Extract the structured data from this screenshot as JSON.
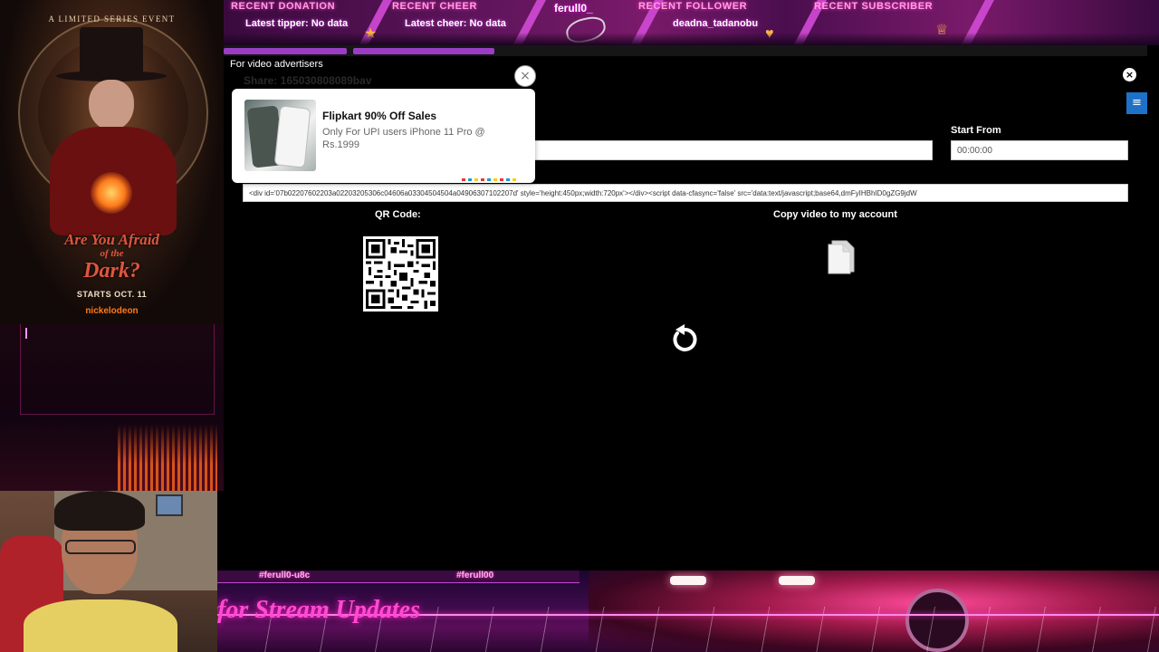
{
  "top_banner": {
    "recent_donation": {
      "label": "RECENT DONATION",
      "value": "Latest tipper: No data"
    },
    "recent_cheer": {
      "label": "RECENT CHEER",
      "value": "Latest cheer: No data"
    },
    "streamer": "ferull0_",
    "recent_follower": {
      "label": "RECENT FOLLOWER",
      "value": "deadna_tadanobu"
    },
    "recent_subscriber": {
      "label": "RECENT SUBSCRIBER"
    }
  },
  "poster": {
    "tagline": "A LIMITED SERIES EVENT",
    "title_line1": "Are You Afraid",
    "title_line2": "of the",
    "title_line3": "Dark?",
    "starts": "STARTS OCT. 11",
    "network": "nickelodeon"
  },
  "bottom_banner": {
    "handle_left": "#ferull0-u8c",
    "handle_right": "#ferull00",
    "script_text": "for Stream Updates"
  },
  "modal": {
    "header": "For video advertisers",
    "share_faint": "Share: 165030808089bav",
    "menu_glyph": "≡",
    "close_glyph": "×",
    "video_url": {
      "value": "",
      "placeholder": ""
    },
    "start_from": {
      "label": "Start From",
      "value": "00:00:00"
    },
    "embed_code": "<div id='07b02207602203a02203205306c04606a03304504504a04906307102207d' style='height:450px;width:720px'></div><script data-cfasync='false' src='data:text/javascript;base64,dmFyIHBhID0gZG9jdW",
    "qr_label": "QR Code:",
    "copy_label": "Copy video to my account"
  },
  "ad": {
    "title": "Flipkart 90% Off Sales",
    "description": "Only For UPI users iPhone 11 Pro @ Rs.1999",
    "close_glyph": "×"
  },
  "icons": {
    "copy": "document-copy-icon",
    "reload": "reload-icon",
    "close": "close-icon",
    "menu": "hamburger-menu-icon",
    "qr": "qr-code-icon"
  },
  "colors": {
    "accent_purple": "#9a3dc4",
    "menu_blue": "#1d72c8",
    "neon_pink": "#ff3acb",
    "background": "#000000"
  }
}
